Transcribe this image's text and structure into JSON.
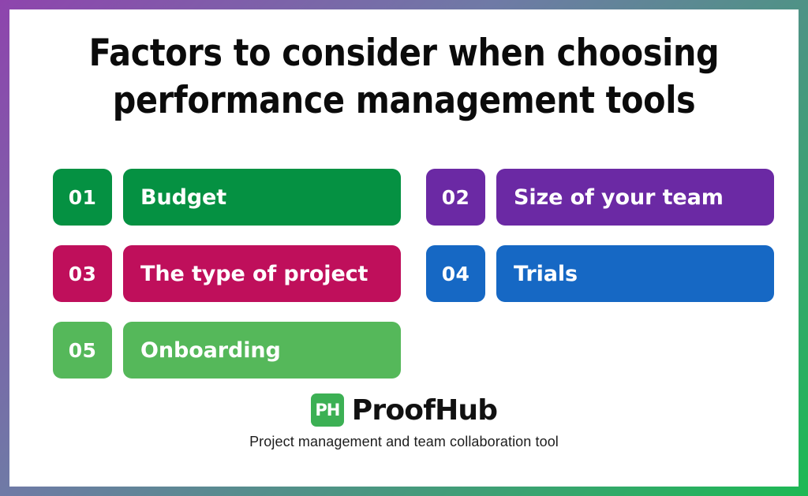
{
  "frame": {
    "border_gradient_start": "#8e44ad",
    "border_gradient_mid": "#6f7aa6",
    "border_gradient_end": "#1db954",
    "background": "#ffffff"
  },
  "title": {
    "text": "Factors to consider when choosing\nperformance management tools",
    "color": "#0b0b0b"
  },
  "factors": [
    {
      "number": "01",
      "label": "Budget",
      "color": "#059142"
    },
    {
      "number": "02",
      "label": "Size of your team",
      "color": "#6b29a4"
    },
    {
      "number": "03",
      "label": "The type of project",
      "color": "#bf0f5b"
    },
    {
      "number": "04",
      "label": "Trials",
      "color": "#1668c4"
    },
    {
      "number": "05",
      "label": "Onboarding",
      "color": "#55b85a"
    }
  ],
  "brand": {
    "mark_text": "PH",
    "mark_color": "#3cb054",
    "name": "ProofHub",
    "tagline": "Project management and team collaboration tool"
  }
}
